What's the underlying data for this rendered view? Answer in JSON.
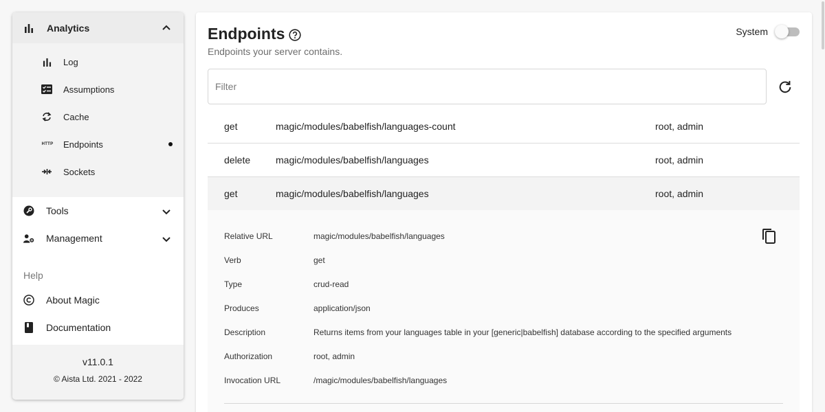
{
  "sidebar": {
    "analytics": {
      "label": "Analytics",
      "icon": "bar-chart-icon"
    },
    "analytics_items": [
      {
        "label": "Log",
        "icon": "bar-chart-icon"
      },
      {
        "label": "Assumptions",
        "icon": "checklist-icon"
      },
      {
        "label": "Cache",
        "icon": "refresh-icon"
      },
      {
        "label": "Endpoints",
        "icon": "http-icon",
        "icon_text": "HTTP"
      },
      {
        "label": "Sockets",
        "icon": "sockets-icon"
      }
    ],
    "tools": {
      "label": "Tools",
      "icon": "wrench-icon"
    },
    "management": {
      "label": "Management",
      "icon": "manage-accounts-icon"
    },
    "help_header": "Help",
    "help_items": [
      {
        "label": "About Magic",
        "icon": "copyright-icon"
      },
      {
        "label": "Documentation",
        "icon": "book-icon"
      }
    ],
    "version": "v11.0.1",
    "copyright": "© Aista Ltd. 2021 - 2022"
  },
  "main": {
    "title": "Endpoints",
    "subtitle": "Endpoints your server contains.",
    "system_label": "System",
    "system_on": false,
    "filter_placeholder": "Filter",
    "endpoints": [
      {
        "verb": "get",
        "url": "magic/modules/babelfish/languages-count",
        "auth": "root, admin"
      },
      {
        "verb": "delete",
        "url": "magic/modules/babelfish/languages",
        "auth": "root, admin"
      },
      {
        "verb": "get",
        "url": "magic/modules/babelfish/languages",
        "auth": "root, admin"
      }
    ],
    "details": [
      {
        "key": "Relative URL",
        "value": "magic/modules/babelfish/languages"
      },
      {
        "key": "Verb",
        "value": "get"
      },
      {
        "key": "Type",
        "value": "crud-read"
      },
      {
        "key": "Produces",
        "value": "application/json"
      },
      {
        "key": "Description",
        "value": "Returns items from your languages table in your [generic|babelfish] database according to the specified arguments"
      },
      {
        "key": "Authorization",
        "value": "root, admin"
      },
      {
        "key": "Invocation URL",
        "value": "/magic/modules/babelfish/languages"
      }
    ]
  }
}
